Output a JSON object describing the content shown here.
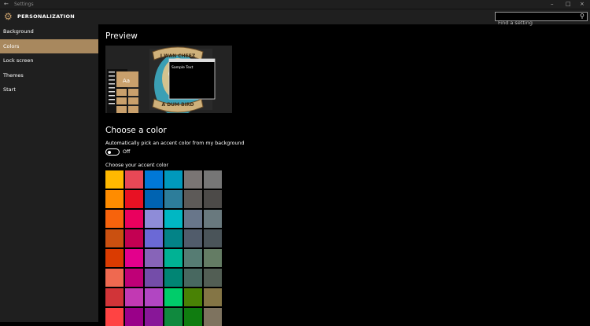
{
  "window": {
    "title": "Settings"
  },
  "header": {
    "app_title": "PERSONALIZATION",
    "search_placeholder": "Find a setting"
  },
  "sidebar": {
    "items": [
      {
        "label": "Background",
        "active": false
      },
      {
        "label": "Colors",
        "active": true
      },
      {
        "label": "Lock screen",
        "active": false
      },
      {
        "label": "Themes",
        "active": false
      },
      {
        "label": "Start",
        "active": false
      }
    ]
  },
  "main": {
    "preview_heading": "Preview",
    "preview": {
      "tile_text": "Aa",
      "window_text": "Sample Text",
      "wallpaper_text_top": "I WAN CHEEZ",
      "wallpaper_text_bottom": "A DUM BIRD",
      "accent": "#c9a06c"
    },
    "choose_heading": "Choose a color",
    "auto_label": "Automatically pick an accent color from my background",
    "toggle_state": "Off",
    "toggle_on": false,
    "accent_label": "Choose your accent color",
    "swatch_rows": [
      [
        "#ffb900",
        "#e74856",
        "#0078d7",
        "#0099bc",
        "#7a7574",
        "#767676"
      ],
      [
        "#ff8c00",
        "#e81123",
        "#0063b1",
        "#2d7d9a",
        "#5d5a58",
        "#4c4a48"
      ],
      [
        "#f7630c",
        "#ea005e",
        "#8e8cd8",
        "#00b7c3",
        "#68768a",
        "#69797e"
      ],
      [
        "#ca5010",
        "#c30052",
        "#6b69d6",
        "#038387",
        "#515c6b",
        "#4a5459"
      ],
      [
        "#da3b01",
        "#e3008c",
        "#8764b8",
        "#00b294",
        "#567c73",
        "#647c64"
      ],
      [
        "#ef6950",
        "#bf0077",
        "#744da9",
        "#018574",
        "#486860",
        "#525e54"
      ],
      [
        "#d13438",
        "#c239b3",
        "#b146c2",
        "#00cc6a",
        "#498205",
        "#847545"
      ],
      [
        "#ff4343",
        "#9a0089",
        "#881798",
        "#10893e",
        "#107c10",
        "#7e735f"
      ]
    ]
  }
}
